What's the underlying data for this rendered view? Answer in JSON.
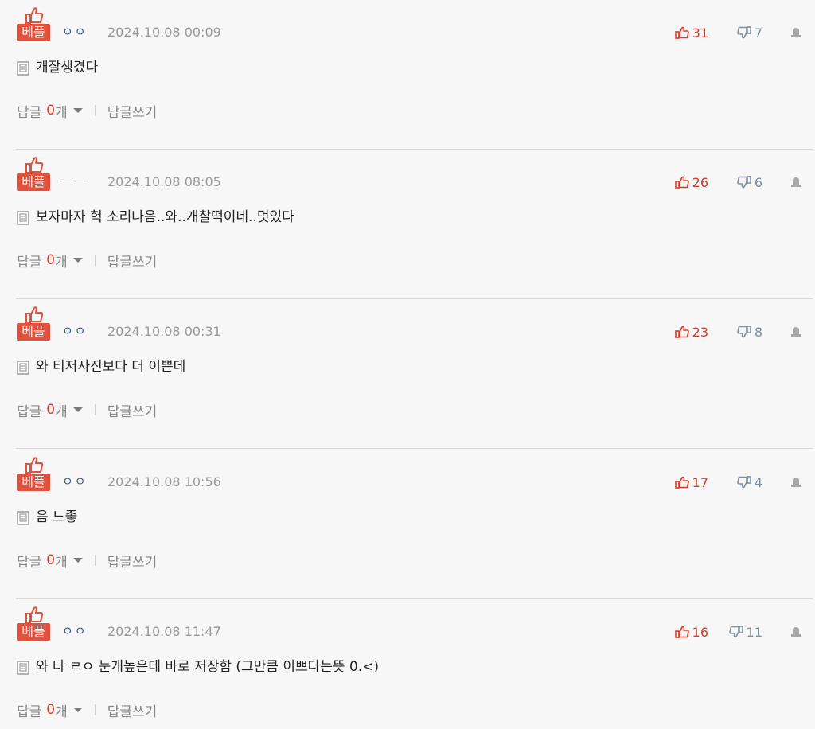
{
  "labels": {
    "best_badge": "베플",
    "reply_label": "답글",
    "reply_unit": "개",
    "write_reply": "답글쓰기"
  },
  "colors": {
    "badge": "#e0523e",
    "up_vote": "#d93a2b",
    "down_vote": "#7f8fa0",
    "author": "#3a5a98",
    "date": "#9a9a9a",
    "background": "#f7f7f7"
  },
  "icons": {
    "best": "thumbs-up-icon",
    "up": "thumbs-up-icon",
    "down": "thumbs-down-icon",
    "report": "report-icon",
    "body": "memo-icon",
    "toggle": "caret-down-icon"
  },
  "comments": [
    {
      "author": "ㅇㅇ",
      "date": "2024.10.08 00:09",
      "up": "31",
      "down": "7",
      "text": "개잘생겼다",
      "reply_count": "0"
    },
    {
      "author": "ㅡㅡ",
      "date": "2024.10.08 08:05",
      "up": "26",
      "down": "6",
      "text": "보자마자 헉 소리나옴..와..개찰떡이네..멋있다",
      "reply_count": "0"
    },
    {
      "author": "ㅇㅇ",
      "date": "2024.10.08 00:31",
      "up": "23",
      "down": "8",
      "text": "와 티저사진보다 더 이쁜데",
      "reply_count": "0"
    },
    {
      "author": "ㅇㅇ",
      "date": "2024.10.08 10:56",
      "up": "17",
      "down": "4",
      "text": "음 느좋",
      "reply_count": "0"
    },
    {
      "author": "ㅇㅇ",
      "date": "2024.10.08 11:47",
      "up": "16",
      "down": "11",
      "text": "와 나 ㄹㅇ 눈개높은데 바로 저장함 (그만큼 이쁘다는뜻 0.<)",
      "reply_count": "0"
    }
  ]
}
